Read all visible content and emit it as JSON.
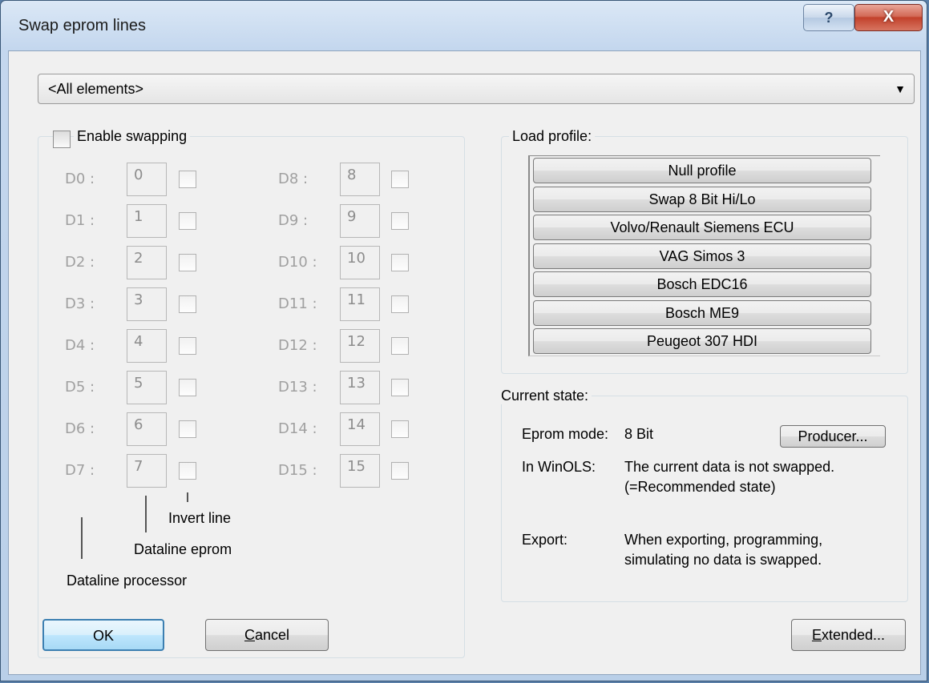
{
  "window": {
    "title": "Swap eprom lines",
    "help_glyph": "?",
    "close_glyph": "X"
  },
  "element_select": {
    "value": "<All elements>"
  },
  "swap_group": {
    "enable_label": "Enable swapping",
    "left_rows": [
      {
        "label": "D0 :",
        "value": "0"
      },
      {
        "label": "D1 :",
        "value": "1"
      },
      {
        "label": "D2 :",
        "value": "2"
      },
      {
        "label": "D3 :",
        "value": "3"
      },
      {
        "label": "D4 :",
        "value": "4"
      },
      {
        "label": "D5 :",
        "value": "5"
      },
      {
        "label": "D6 :",
        "value": "6"
      },
      {
        "label": "D7 :",
        "value": "7"
      }
    ],
    "right_rows": [
      {
        "label": "D8 :",
        "value": "8"
      },
      {
        "label": "D9 :",
        "value": "9"
      },
      {
        "label": "D10 :",
        "value": "10"
      },
      {
        "label": "D11 :",
        "value": "11"
      },
      {
        "label": "D12 :",
        "value": "12"
      },
      {
        "label": "D13 :",
        "value": "13"
      },
      {
        "label": "D14 :",
        "value": "14"
      },
      {
        "label": "D15 :",
        "value": "15"
      }
    ],
    "invert_caption": "Invert line",
    "eprom_caption": "Dataline eprom",
    "processor_caption": "Dataline processor"
  },
  "load_profile": {
    "label": "Load profile:",
    "profiles": [
      "Null profile",
      "Swap 8 Bit Hi/Lo",
      "Volvo/Renault Siemens ECU",
      "VAG Simos 3",
      "Bosch EDC16",
      "Bosch ME9",
      "Peugeot 307 HDI"
    ]
  },
  "current_state": {
    "label": "Current state:",
    "eprom_mode_label": "Eprom mode:",
    "eprom_mode_value": "8 Bit",
    "producer_button": "Producer...",
    "winols_label": "In WinOLS:",
    "winols_line1": "The current data is not swapped.",
    "winols_line2": "(=Recommended state)",
    "export_label": "Export:",
    "export_line1": "When exporting, programming,",
    "export_line2": "simulating no data is swapped."
  },
  "buttons": {
    "ok": "OK",
    "cancel_prefix": "C",
    "cancel_rest": "ancel",
    "extended_prefix": "E",
    "extended_rest": "xtended..."
  }
}
